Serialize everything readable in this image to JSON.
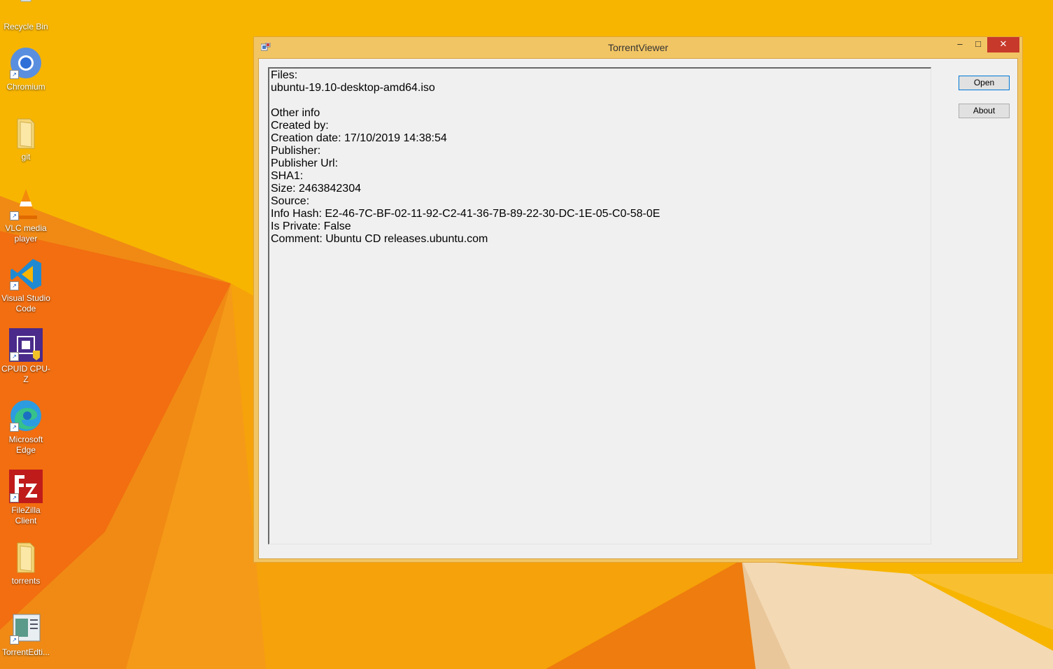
{
  "desktop": {
    "icons": [
      {
        "label": "Recycle Bin",
        "icon": "recycle-bin-icon"
      },
      {
        "label": "Chromium",
        "icon": "chromium-icon"
      },
      {
        "label": "git",
        "icon": "folder-icon"
      },
      {
        "label": "VLC media player",
        "icon": "vlc-icon"
      },
      {
        "label": "Visual Studio Code",
        "icon": "vscode-icon"
      },
      {
        "label": "CPUID CPU-Z",
        "icon": "cpuz-icon"
      },
      {
        "label": "Microsoft Edge",
        "icon": "edge-icon"
      },
      {
        "label": "FileZilla Client",
        "icon": "filezilla-icon"
      },
      {
        "label": "torrents",
        "icon": "folder-icon"
      },
      {
        "label": "TorrentEdti...",
        "icon": "torrent-editor-icon"
      }
    ]
  },
  "window": {
    "title": "TorrentViewer",
    "minimize_label": "–",
    "maximize_label": "□",
    "close_label": "✕",
    "info_lines": [
      "Files:",
      "ubuntu-19.10-desktop-amd64.iso",
      "",
      "Other info",
      "Created by:",
      "Creation date: 17/10/2019 14:38:54",
      "Publisher:",
      "Publisher Url:",
      "SHA1:",
      "Size: 2463842304",
      "Source:",
      "Info Hash: E2-46-7C-BF-02-11-92-C2-41-36-7B-89-22-30-DC-1E-05-C0-58-0E",
      "Is Private: False",
      "Comment: Ubuntu CD releases.ubuntu.com"
    ],
    "buttons": {
      "open_label": "Open",
      "about_label": "About"
    }
  },
  "colors": {
    "wallpaper_base": "#f6b000",
    "wallpaper_orange": "#f07b12",
    "window_frame": "#f2c564",
    "close_button": "#c7392b"
  }
}
